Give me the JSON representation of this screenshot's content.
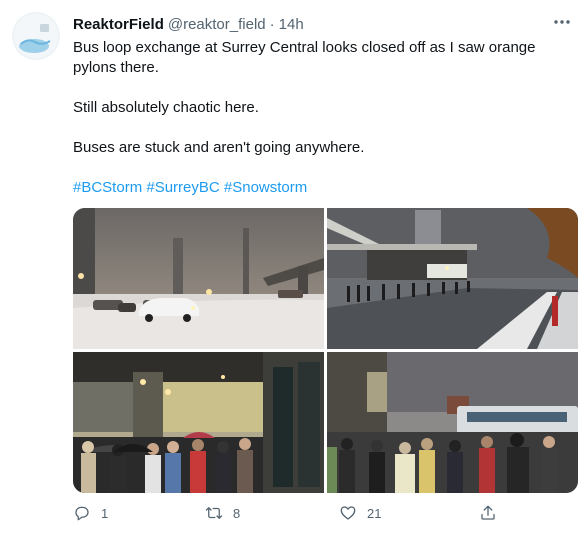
{
  "tweet": {
    "name": "ReaktorField",
    "handle": "@reaktor_field",
    "separator": "·",
    "time": "14h",
    "text_lines": [
      "Bus loop exchange at Surrey Central looks closed off as I saw orange pylons there.",
      "Still absolutely chaotic here.",
      "Buses are stuck and aren't going anywhere."
    ],
    "hashtags": "#BCStorm #SurreyBC #Snowstorm",
    "more_icon": "more-horizontal-icon"
  },
  "media": {
    "photo_count": 4,
    "photos": [
      "snowy-road-cars-photo",
      "bus-loop-night-crowd-photo",
      "crowd-umbrellas-photo",
      "crowd-buses-photo"
    ]
  },
  "actions": {
    "reply_count": "1",
    "retweet_count": "8",
    "like_count": "21",
    "icons": [
      "reply-icon",
      "retweet-icon",
      "like-icon",
      "share-icon"
    ]
  },
  "colors": {
    "accent": "#1d9bf0",
    "secondary_text": "#536471",
    "primary_text": "#0f1419"
  }
}
